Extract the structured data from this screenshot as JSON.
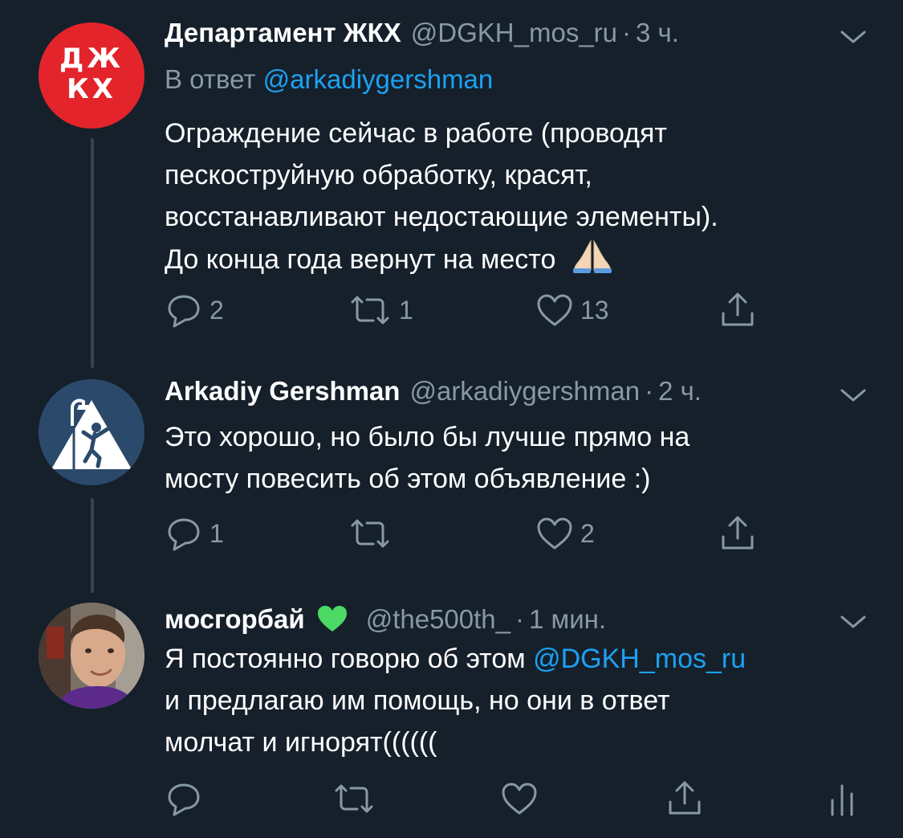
{
  "tweets": [
    {
      "name": "Департамент ЖКХ",
      "handle": "@DGKH_mos_ru",
      "sep": "·",
      "time": "3 ч.",
      "reply_prefix": "В ответ",
      "reply_to": "@arkadiygershman",
      "avatar_text": [
        "ДЖ",
        "КХ"
      ],
      "body_lines": [
        "Ограждение сейчас в работе (проводят",
        "пескоструйную обработку, красят,",
        "восстанавливают недостающие элементы).",
        "До конца года вернут на место"
      ],
      "body_emoji": "🙏",
      "replies": "2",
      "retweets": "1",
      "likes": "13"
    },
    {
      "name": "Arkadiy Gershman",
      "handle": "@arkadiygershman",
      "sep": "·",
      "time": "2 ч.",
      "body_lines": [
        "Это хорошо, но было бы лучше прямо на",
        "мосту повесить об этом объявление :)"
      ],
      "replies": "1",
      "retweets": "",
      "likes": "2"
    },
    {
      "name": "мосгорбай",
      "name_emoji": "💚",
      "handle": "@the500th_",
      "sep": "·",
      "time": "1 мин.",
      "body_prefix": "Я постоянно говорю об этом ",
      "body_mention": "@DGKH_mos_ru",
      "body_lines": [
        "и предлагаю им помощь, но они в ответ",
        "молчат и игнорят(((((("
      ],
      "replies": "",
      "retweets": "",
      "likes": ""
    }
  ],
  "icons": {
    "reply": "reply-icon",
    "retweet": "retweet-icon",
    "like": "like-icon",
    "share": "share-icon",
    "analytics": "analytics-icon",
    "caret": "chevron-down-icon"
  },
  "colors": {
    "background": "#15202b",
    "secondary_text": "#8899a6",
    "link": "#1da1f2",
    "thread_line": "#38444d",
    "dgkh_red": "#e3242b",
    "heart_green": "#4cd964"
  }
}
